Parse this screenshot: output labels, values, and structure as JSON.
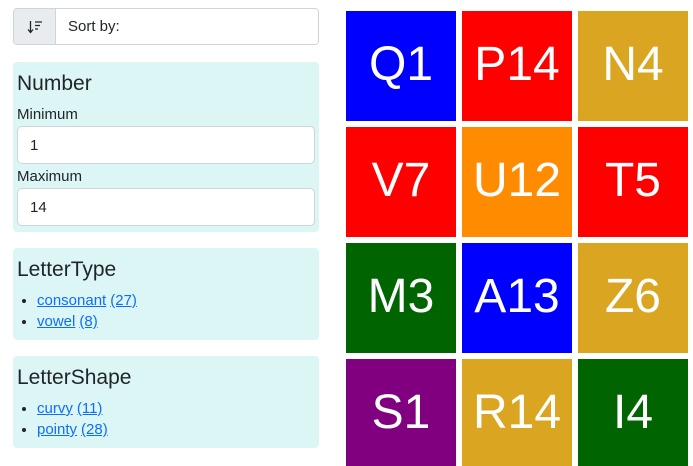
{
  "sort": {
    "label": "Sort by:",
    "icon": "sort-descending-icon"
  },
  "number_filter": {
    "title": "Number",
    "min_label": "Minimum",
    "min_value": "1",
    "max_label": "Maximum",
    "max_value": "14"
  },
  "letter_type": {
    "title": "LetterType",
    "items": [
      {
        "label": "consonant",
        "count": "(27)"
      },
      {
        "label": "vowel",
        "count": "(8)"
      }
    ]
  },
  "letter_shape": {
    "title": "LetterShape",
    "items": [
      {
        "label": "curvy",
        "count": "(11)"
      },
      {
        "label": "pointy",
        "count": "(28)"
      }
    ]
  },
  "tiles": [
    {
      "label": "Q1",
      "color": "#0000ff"
    },
    {
      "label": "P14",
      "color": "#ff0000"
    },
    {
      "label": "N4",
      "color": "#daa520"
    },
    {
      "label": "V7",
      "color": "#ff0000"
    },
    {
      "label": "U12",
      "color": "#ff8c00"
    },
    {
      "label": "T5",
      "color": "#ff0000"
    },
    {
      "label": "M3",
      "color": "#006400"
    },
    {
      "label": "A13",
      "color": "#0000ff"
    },
    {
      "label": "Z6",
      "color": "#daa520"
    },
    {
      "label": "S1",
      "color": "#800080"
    },
    {
      "label": "R14",
      "color": "#daa520"
    },
    {
      "label": "I4",
      "color": "#006400"
    }
  ]
}
